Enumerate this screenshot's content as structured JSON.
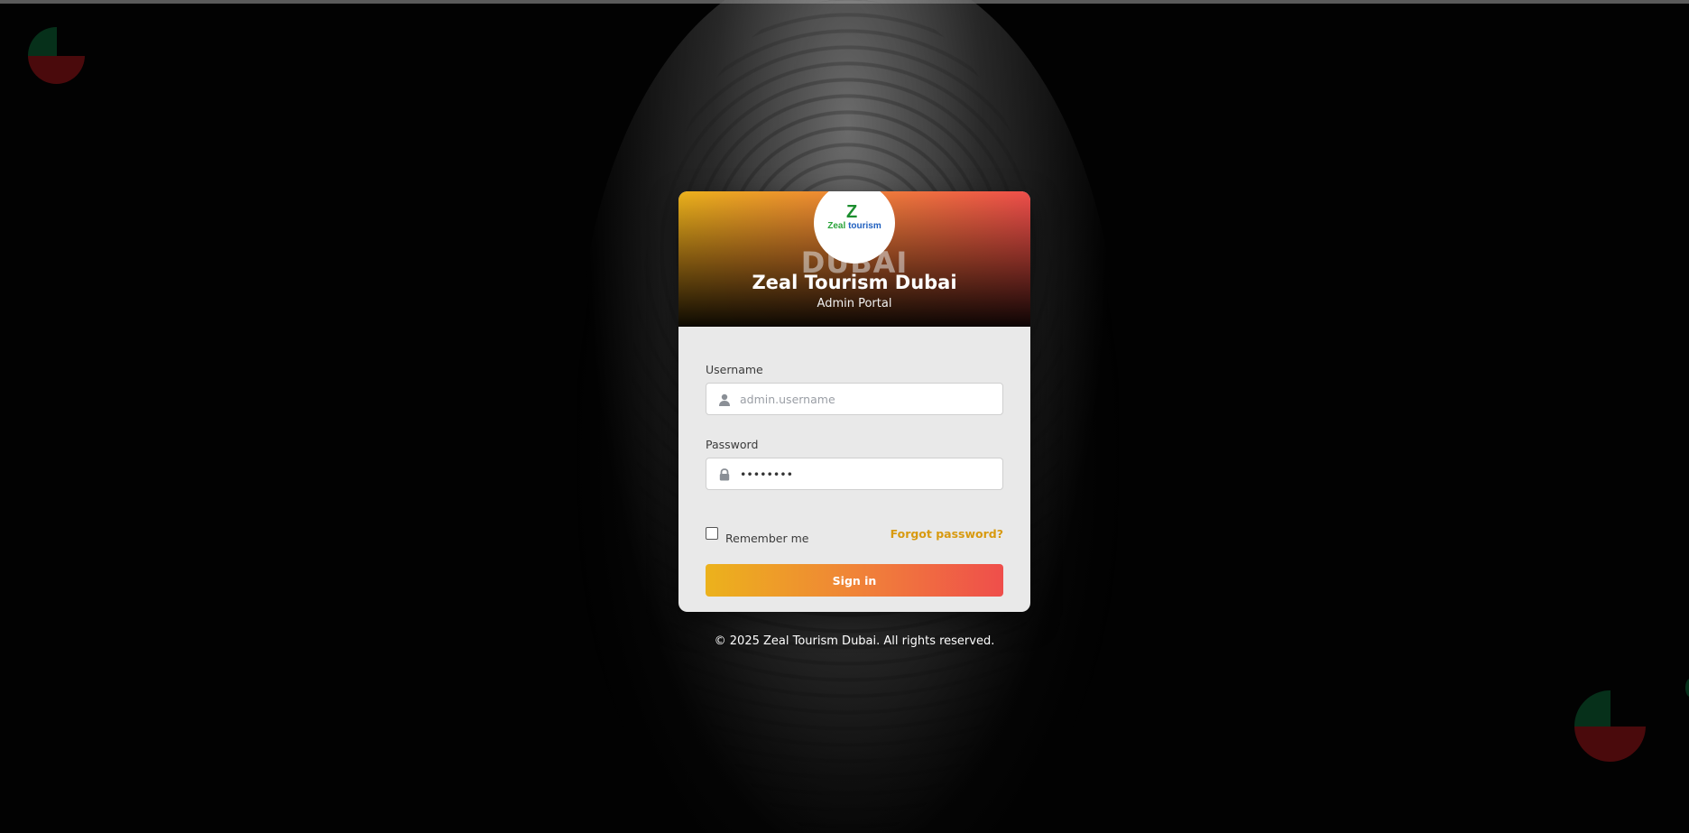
{
  "brand": {
    "logo_mark": "Z",
    "logo_word_1": "Zeal",
    "logo_word_2": "tourism",
    "city": "DUBAI",
    "title": "Zeal Tourism Dubai",
    "subtitle": "Admin Portal"
  },
  "form": {
    "username_label": "Username",
    "username_placeholder": "admin.username",
    "username_value": "",
    "username_icon": "user-icon",
    "password_label": "Password",
    "password_value": "••••••••",
    "password_icon": "lock-icon",
    "remember_label": "Remember me",
    "remember_checked": false,
    "forgot_label": "Forgot password?",
    "signin_label": "Sign in"
  },
  "footer": {
    "copyright": "© 2025 Zeal Tourism Dubai. All rights reserved."
  },
  "colors": {
    "gradient_start": "#ecb21c",
    "gradient_mid": "#f07f3a",
    "gradient_end": "#ef4e4b",
    "link": "#d89a10",
    "background": "#020202"
  }
}
